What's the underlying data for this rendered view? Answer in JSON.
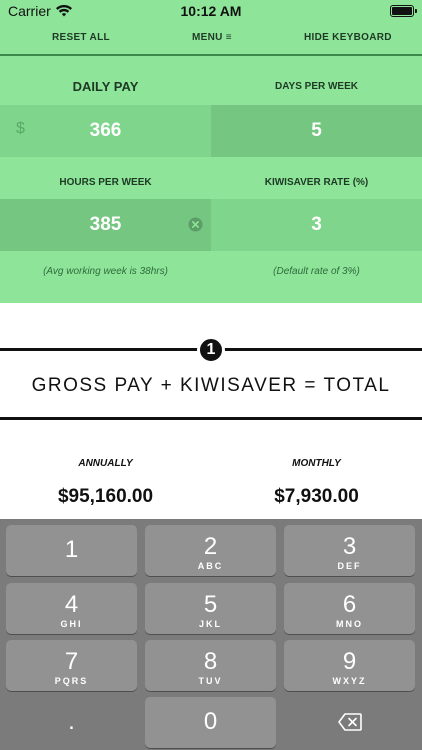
{
  "status_bar": {
    "carrier": "Carrier",
    "time": "10:12 AM"
  },
  "menu": {
    "reset_all": "RESET ALL",
    "menu": "MENU ≡",
    "hide_keyboard": "HIDE KEYBOARD"
  },
  "inputs": {
    "daily_pay": {
      "label": "DAILY PAY",
      "currency": "$",
      "value": "366"
    },
    "days_per_week": {
      "label": "DAYS PER WEEK",
      "value": "5"
    },
    "hours_per_week": {
      "label": "HOURS PER WEEK",
      "value": "385",
      "hint": "(Avg working week is 38hrs)"
    },
    "kiwisaver_rate": {
      "label": "KIWISAVER RATE (%)",
      "value": "3",
      "hint": "(Default rate of 3%)"
    }
  },
  "section": {
    "step": "1",
    "formula": "GROSS PAY + KIWISAVER = TOTAL"
  },
  "results": {
    "annually": {
      "label": "ANNUALLY",
      "value": "$95,160.00"
    },
    "monthly": {
      "label": "MONTHLY",
      "value": "$7,930.00"
    }
  },
  "keyboard": {
    "keys": [
      {
        "num": "1",
        "letters": ""
      },
      {
        "num": "2",
        "letters": "ABC"
      },
      {
        "num": "3",
        "letters": "DEF"
      },
      {
        "num": "4",
        "letters": "GHI"
      },
      {
        "num": "5",
        "letters": "JKL"
      },
      {
        "num": "6",
        "letters": "MNO"
      },
      {
        "num": "7",
        "letters": "PQRS"
      },
      {
        "num": "8",
        "letters": "TUV"
      },
      {
        "num": "9",
        "letters": "WXYZ"
      },
      {
        "num": ".",
        "letters": ""
      },
      {
        "num": "0",
        "letters": ""
      }
    ]
  },
  "colors": {
    "panel_green": "#8ee59a",
    "field_green": "#7fd58c",
    "field_dark": "#74c680",
    "keyboard_bg": "#7b7b7b",
    "key_bg": "#929292"
  }
}
